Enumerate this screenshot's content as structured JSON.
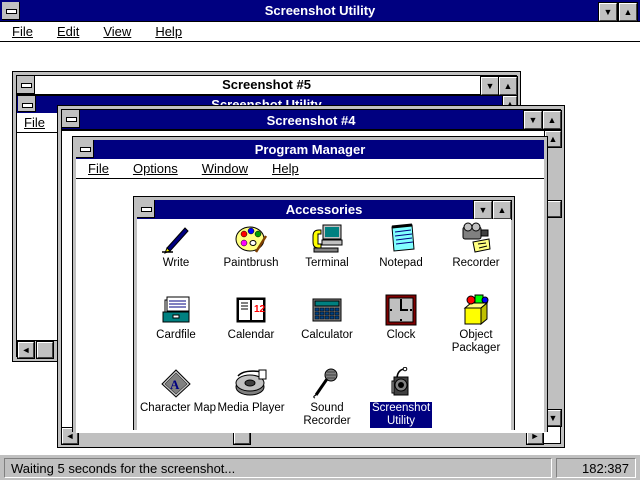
{
  "main_window": {
    "title": "Screenshot Utility",
    "menu": [
      "File",
      "Edit",
      "View",
      "Help"
    ]
  },
  "window_5": {
    "title": "Screenshot #5",
    "inner_title": "Screenshot Utility",
    "inner_menu_first": "File"
  },
  "window_4": {
    "title": "Screenshot #4"
  },
  "program_manager": {
    "title": "Program Manager",
    "menu": [
      "File",
      "Options",
      "Window",
      "Help"
    ]
  },
  "accessories": {
    "title": "Accessories",
    "items": [
      {
        "label": "Write",
        "icon": "write-icon"
      },
      {
        "label": "Paintbrush",
        "icon": "paintbrush-icon"
      },
      {
        "label": "Terminal",
        "icon": "terminal-icon"
      },
      {
        "label": "Notepad",
        "icon": "notepad-icon"
      },
      {
        "label": "Recorder",
        "icon": "recorder-icon"
      },
      {
        "label": "Cardfile",
        "icon": "cardfile-icon"
      },
      {
        "label": "Calendar",
        "icon": "calendar-icon"
      },
      {
        "label": "Calculator",
        "icon": "calculator-icon"
      },
      {
        "label": "Clock",
        "icon": "clock-icon"
      },
      {
        "label": "Object Packager",
        "icon": "object-packager-icon"
      },
      {
        "label": "Character Map",
        "icon": "character-map-icon"
      },
      {
        "label": "Media Player",
        "icon": "media-player-icon"
      },
      {
        "label": "Sound Recorder",
        "icon": "sound-recorder-icon"
      },
      {
        "label": "Screenshot Utility",
        "icon": "screenshot-utility-icon",
        "selected": true
      }
    ]
  },
  "calendar_icon_text": "1 2",
  "status": {
    "message": "Waiting 5 seconds for the screenshot...",
    "coords": "182:387"
  },
  "colors": {
    "active_title": "#000080",
    "frame": "#c0c0c0"
  }
}
